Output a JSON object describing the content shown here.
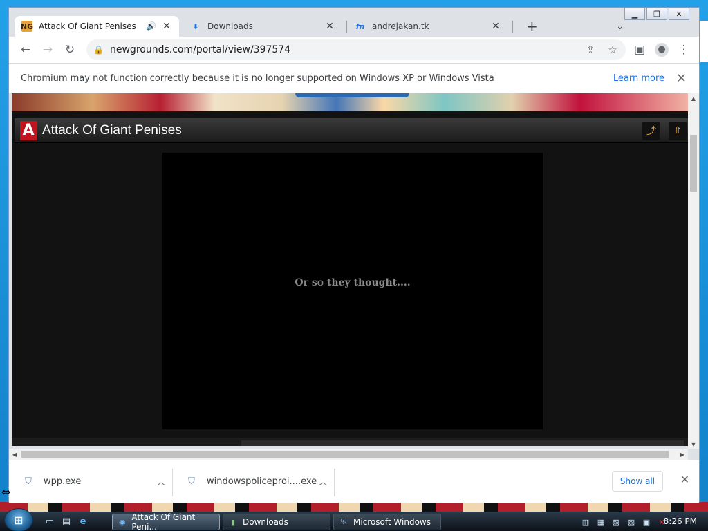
{
  "browser": {
    "tabs": [
      {
        "title": "Attack Of Giant Penises",
        "favicon": "ng-favicon",
        "active": true,
        "audio": true
      },
      {
        "title": "Downloads",
        "favicon": "download-icon",
        "active": false
      },
      {
        "title": "andrejakan.tk",
        "favicon": "fn-favicon",
        "active": false
      }
    ],
    "new_tab": "+",
    "tab_search": "⌄",
    "url": "newgrounds.com/portal/view/397574",
    "infobar": {
      "message": "Chromium may not function correctly because it is no longer supported on Windows XP or Windows Vista",
      "link": "Learn more"
    }
  },
  "page": {
    "player_title": "Attack Of Giant Penises",
    "game_message": "Or so they thought...."
  },
  "downloads": {
    "items": [
      {
        "name": "wpp.exe"
      },
      {
        "name": "windowspoliceproi....exe"
      }
    ],
    "show_all": "Show all"
  },
  "taskbar": {
    "tasks": [
      {
        "label": "Attack Of Giant Peni...",
        "icon": "chromium-icon",
        "active": true
      },
      {
        "label": "Downloads",
        "icon": "folder-icon",
        "active": false
      },
      {
        "label": "Microsoft Windows",
        "icon": "windows-shield-icon",
        "active": false
      }
    ],
    "clock": "8:26 PM"
  }
}
